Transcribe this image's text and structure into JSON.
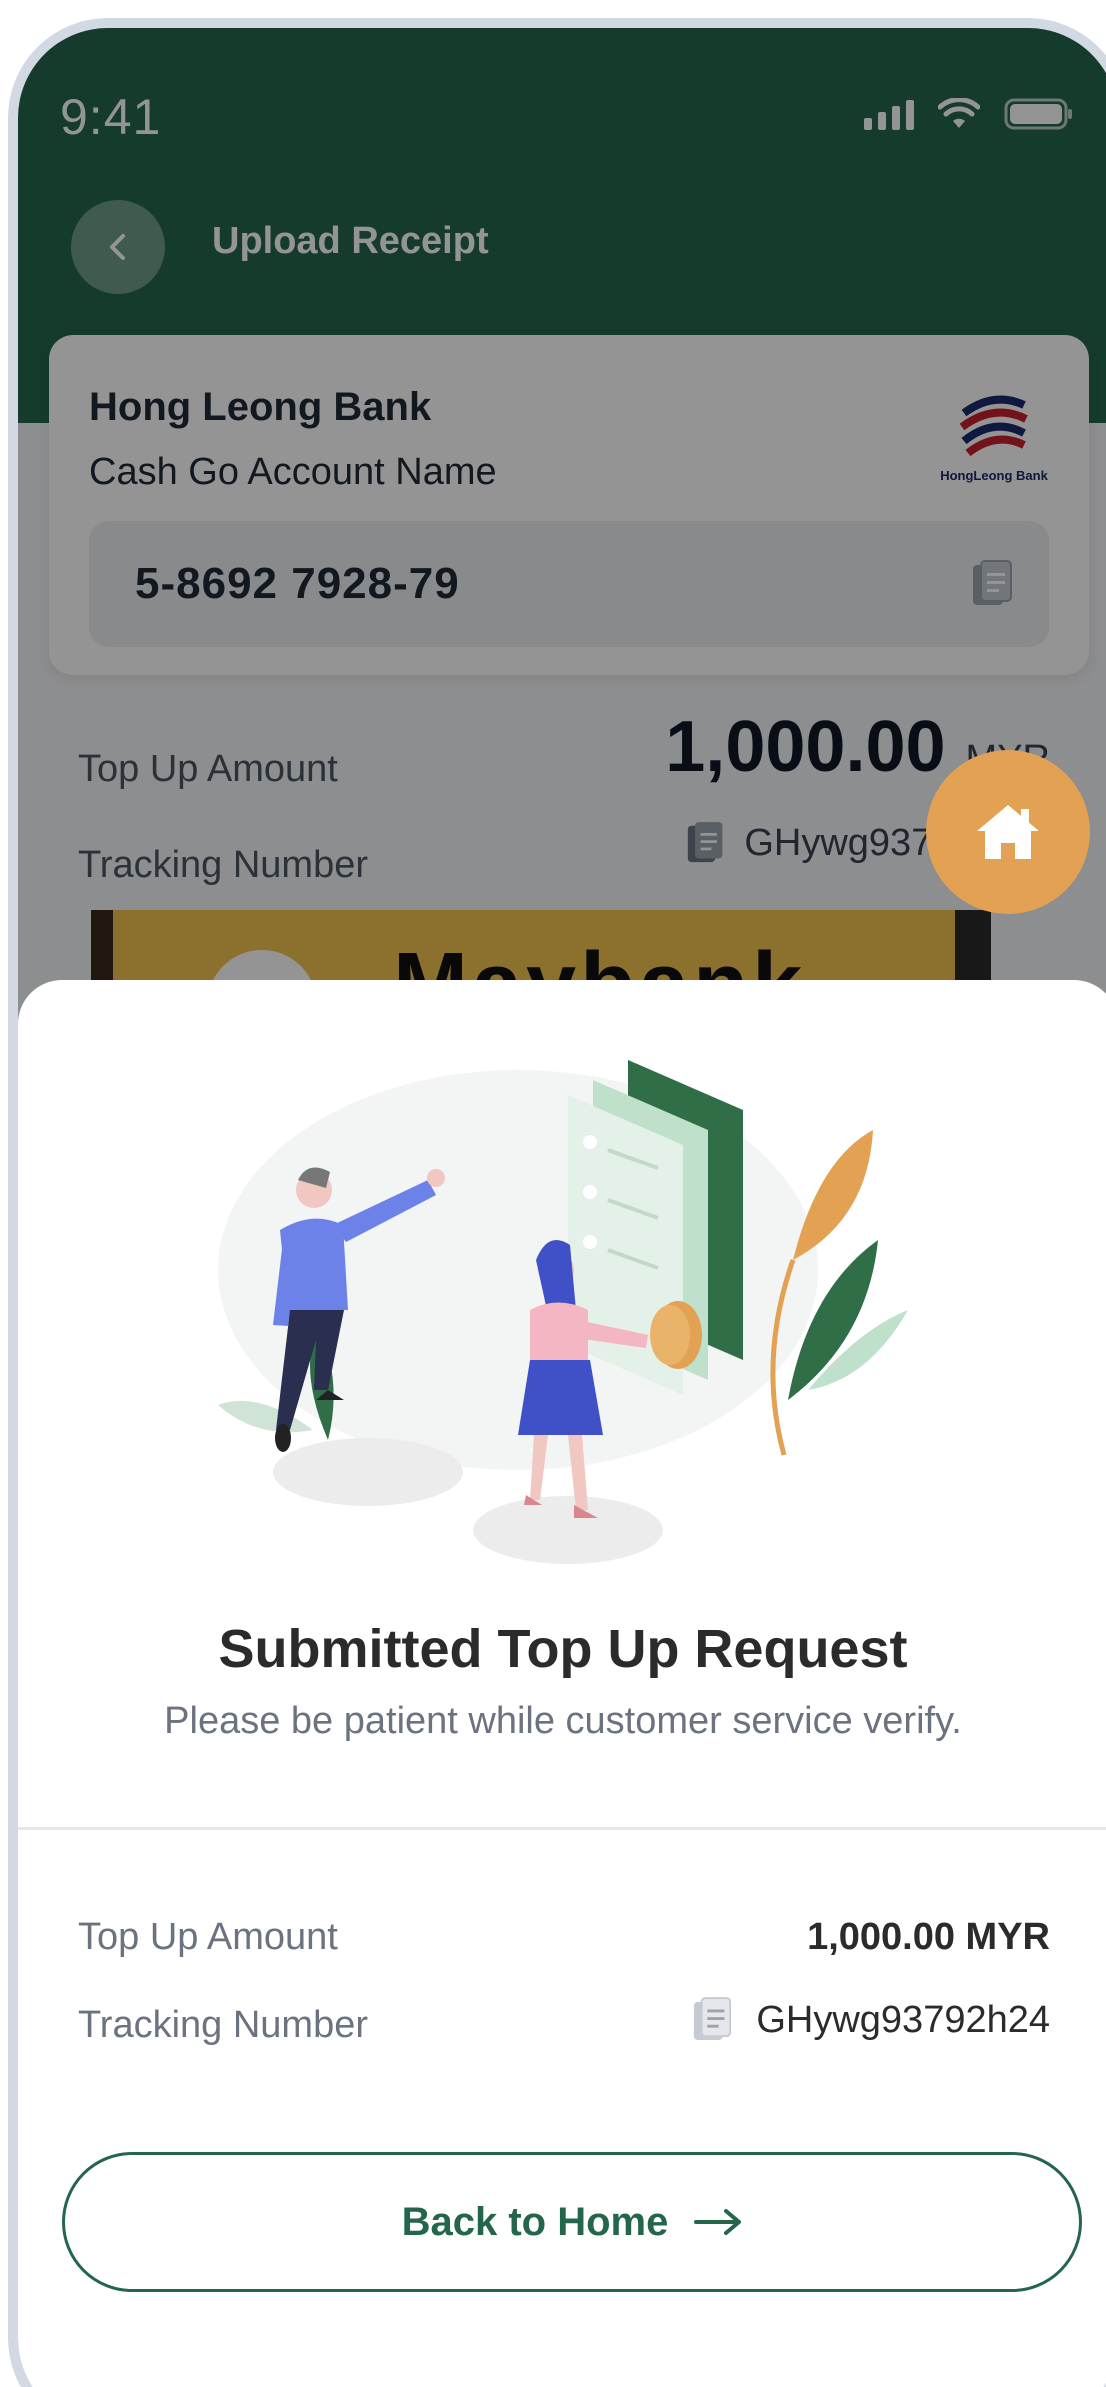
{
  "status_bar": {
    "time": "9:41"
  },
  "header": {
    "title": "Upload Receipt"
  },
  "bank_card": {
    "bank_name": "Hong Leong Bank",
    "account_name": "Cash Go Account Name",
    "account_number": "5-8692 7928-79",
    "logo_text": "HongLeong Bank"
  },
  "background_summary": {
    "amount_label": "Top Up Amount",
    "amount_value": "1,000.00",
    "amount_currency": "MYR",
    "tracking_label": "Tracking Number",
    "tracking_value": "GHywg93792h24"
  },
  "receipt_preview": {
    "text": "Maybank"
  },
  "sheet": {
    "title": "Submitted Top Up Request",
    "subtitle": "Please be patient while customer service verify.",
    "amount_label": "Top Up Amount",
    "amount_value": "1,000.00 MYR",
    "tracking_label": "Tracking Number",
    "tracking_value": "GHywg93792h24",
    "button_label": "Back to Home"
  },
  "colors": {
    "brand_green": "#24664a",
    "accent_orange": "#e2a153"
  },
  "icons": {
    "back": "chevron-left-icon",
    "copy": "copy-icon",
    "home": "home-icon",
    "arrow": "arrow-right-icon"
  }
}
